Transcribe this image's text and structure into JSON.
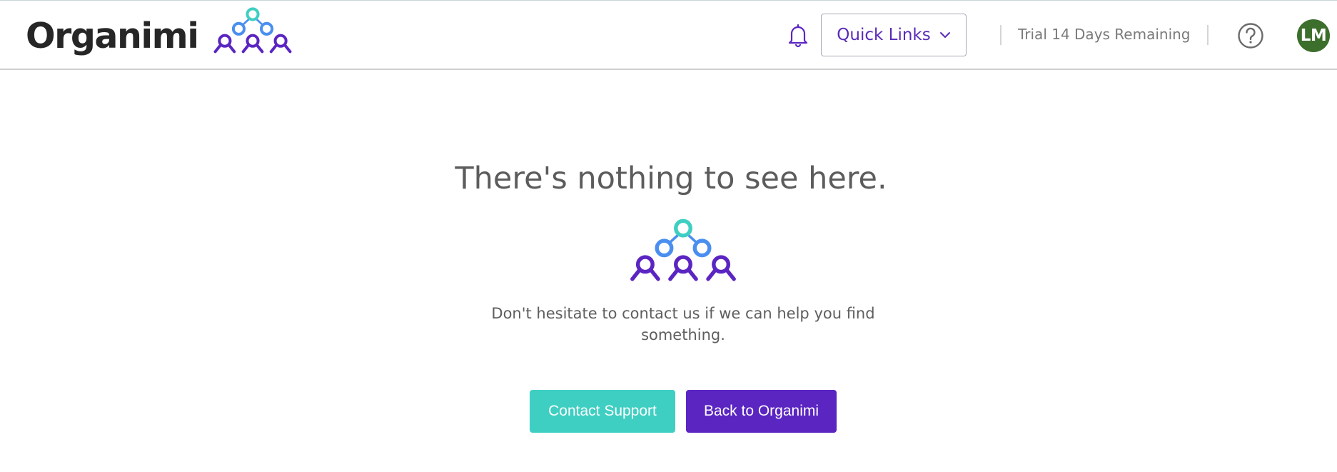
{
  "header": {
    "brand_name": "Organimi",
    "logo_icon": "organimi-people-pyramid-icon",
    "notifications_icon": "bell-icon",
    "quick_links_label": "Quick Links",
    "trial_text": "Trial 14 Days Remaining",
    "help_icon": "question-circle-icon",
    "avatar_initials": "LM"
  },
  "main": {
    "title": "There's nothing to see here.",
    "message": "Don't hesitate to contact us if we can help you find something.",
    "contact_support_label": "Contact Support",
    "back_label": "Back to Organimi"
  },
  "colors": {
    "brand_purple": "#5b25c2",
    "teal": "#3ecfc2",
    "blue": "#4a8ff0",
    "avatar_green": "#3c6e2c",
    "text_gray": "#5c5c5c"
  }
}
